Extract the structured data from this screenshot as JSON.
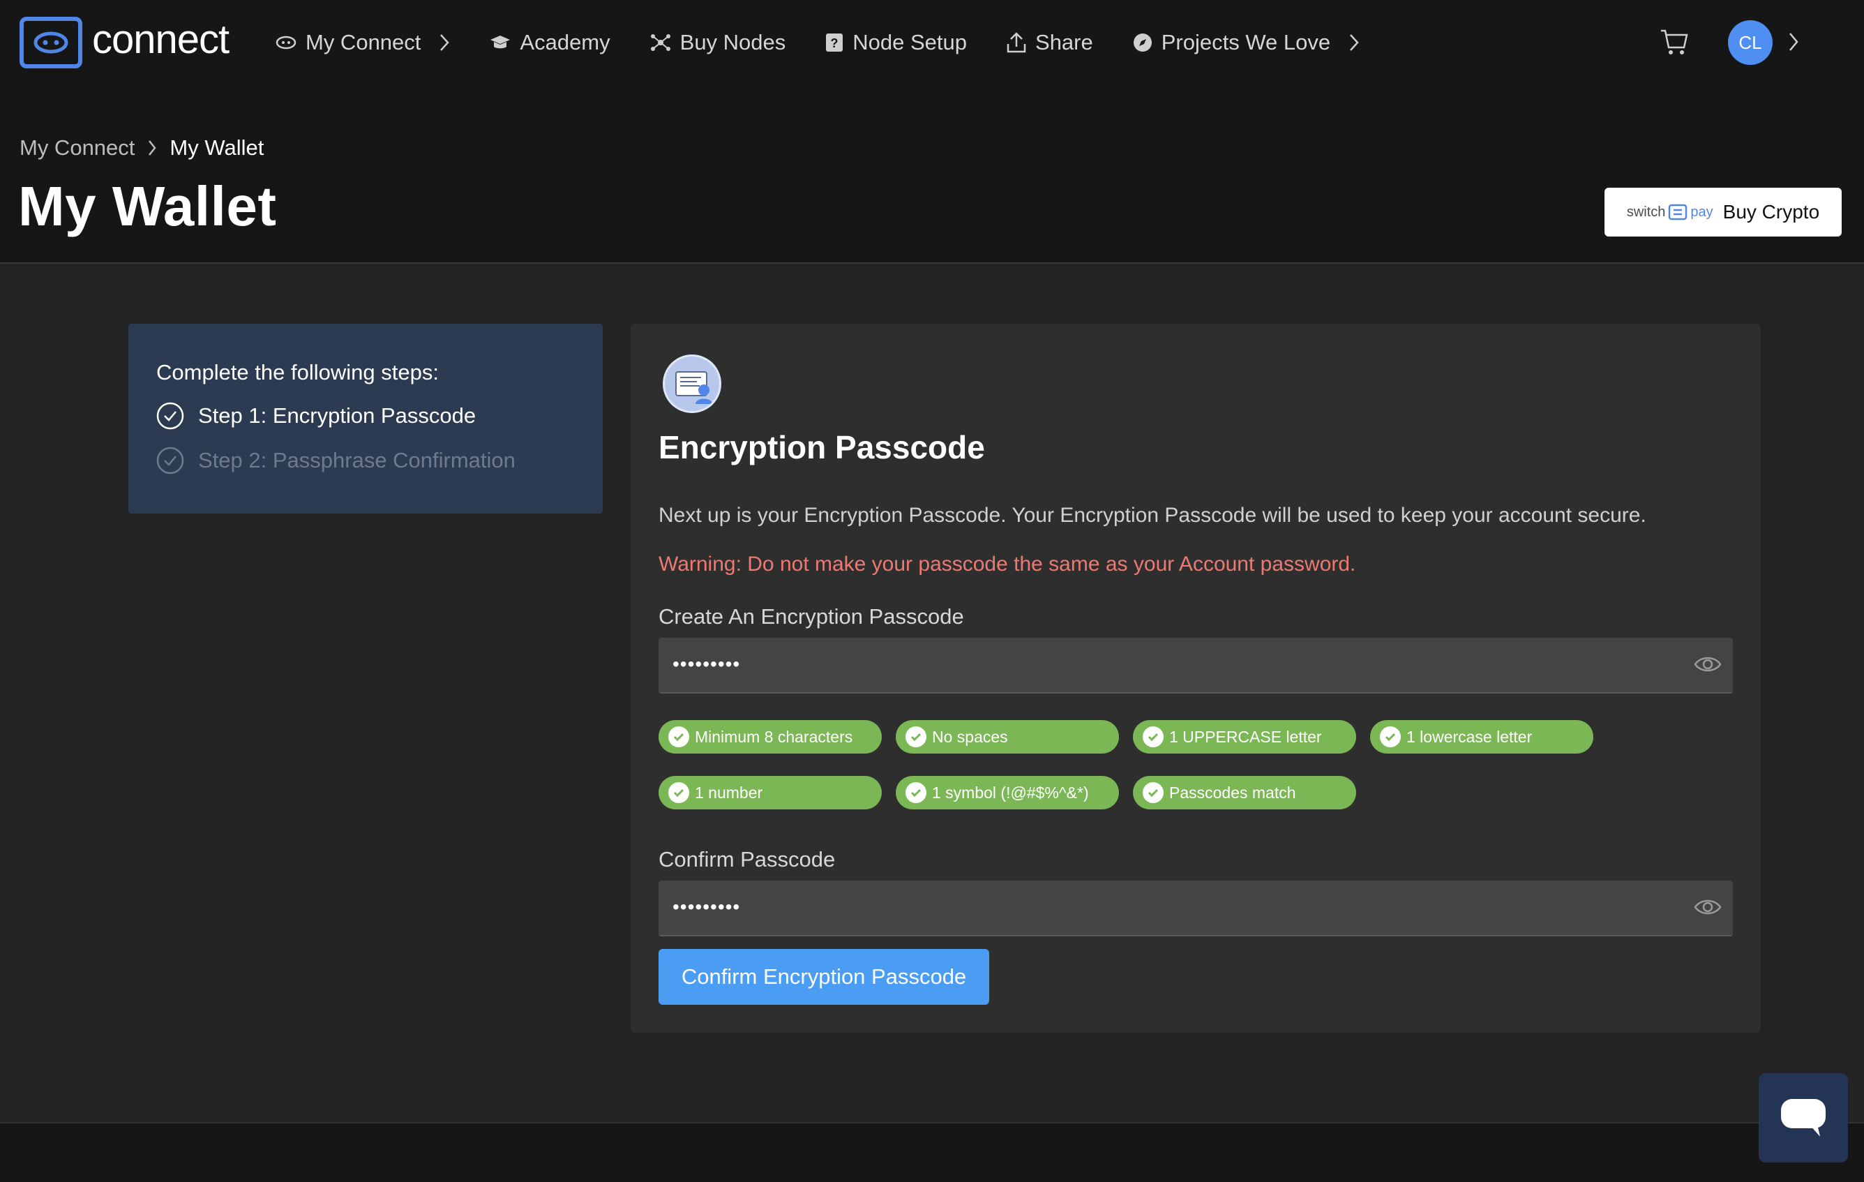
{
  "brand": {
    "name": "connect",
    "accent": "#4f86e8"
  },
  "nav": {
    "items": [
      {
        "label": "My Connect",
        "icon": "eye-icon",
        "has_chevron": true
      },
      {
        "label": "Academy",
        "icon": "graduation-cap-icon",
        "has_chevron": false
      },
      {
        "label": "Buy Nodes",
        "icon": "nodes-icon",
        "has_chevron": false
      },
      {
        "label": "Node Setup",
        "icon": "question-box-icon",
        "has_chevron": false
      },
      {
        "label": "Share",
        "icon": "share-upload-icon",
        "has_chevron": false
      },
      {
        "label": "Projects We Love",
        "icon": "compass-icon",
        "has_chevron": true
      }
    ],
    "user_initials": "CL"
  },
  "breadcrumb": {
    "parent": "My Connect",
    "current": "My Wallet"
  },
  "page_title": "My Wallet",
  "buy_crypto": {
    "brand_left": "switch",
    "brand_right": "pay",
    "label": "Buy Crypto"
  },
  "steps": {
    "heading": "Complete the following steps:",
    "items": [
      {
        "label": "Step 1: Encryption Passcode",
        "state": "active"
      },
      {
        "label": "Step 2: Passphrase Confirmation",
        "state": "inactive"
      }
    ]
  },
  "card": {
    "title": "Encryption Passcode",
    "description": "Next up is your Encryption Passcode. Your Encryption Passcode will be used to keep your account secure.",
    "warning": "Warning: Do not make your passcode the same as your Account password.",
    "create_label": "Create An Encryption Passcode",
    "create_value": "•••••••••",
    "requirements": [
      "Minimum 8 characters",
      "No spaces",
      "1 UPPERCASE letter",
      "1 lowercase letter",
      "1 number",
      "1 symbol (!@#$%^&*)",
      "Passcodes match"
    ],
    "confirm_label": "Confirm Passcode",
    "confirm_value": "•••••••••",
    "submit_label": "Confirm Encryption Passcode"
  },
  "colors": {
    "success": "#7cb756",
    "warning": "#ec7a72",
    "primary_button": "#4a9df3",
    "steps_panel": "#2c3a52"
  }
}
